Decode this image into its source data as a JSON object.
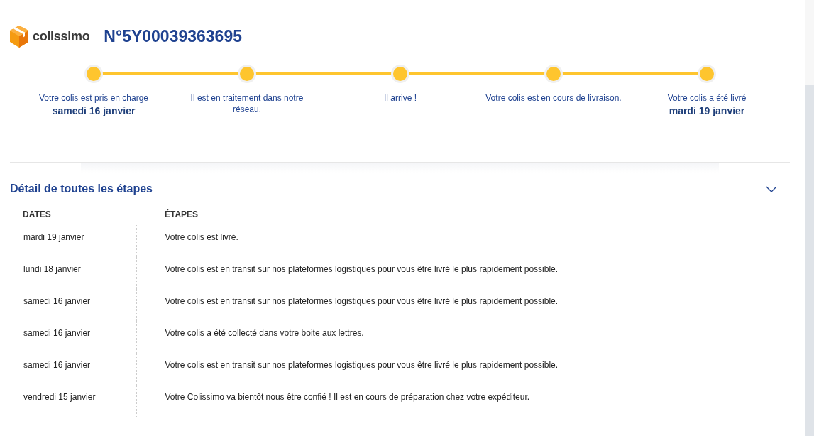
{
  "brand": {
    "name": "colissimo"
  },
  "tracking_number": "N°5Y00039363695",
  "progress": [
    {
      "label": "Votre colis est pris en charge",
      "date": "samedi 16 janvier"
    },
    {
      "label": "Il est en traitement dans notre réseau."
    },
    {
      "label": "Il arrive !"
    },
    {
      "label": "Votre colis est en cours de livraison."
    },
    {
      "label": "Votre colis a été livré",
      "date": "mardi 19 janvier"
    }
  ],
  "details": {
    "title": "Détail de toutes les étapes",
    "expanded": true,
    "columns": [
      "DATES",
      "ÉTAPES"
    ],
    "rows": [
      {
        "date": "mardi 19 janvier",
        "step": "Votre colis est livré."
      },
      {
        "date": "lundi 18 janvier",
        "step": "Votre colis est en transit sur nos plateformes logistiques pour vous être livré le plus rapidement possible."
      },
      {
        "date": "samedi 16 janvier",
        "step": "Votre colis est en transit sur nos plateformes logistiques pour vous être livré le plus rapidement possible."
      },
      {
        "date": "samedi 16 janvier",
        "step": "Votre colis a été collecté dans votre boite aux lettres."
      },
      {
        "date": "samedi 16 janvier",
        "step": "Votre colis est en transit sur nos plateformes logistiques pour vous être livré le plus rapidement possible."
      },
      {
        "date": "vendredi 15 janvier",
        "step": "Votre Colissimo va bientôt nous être confié ! Il est en cours de préparation chez votre expéditeur."
      }
    ]
  }
}
